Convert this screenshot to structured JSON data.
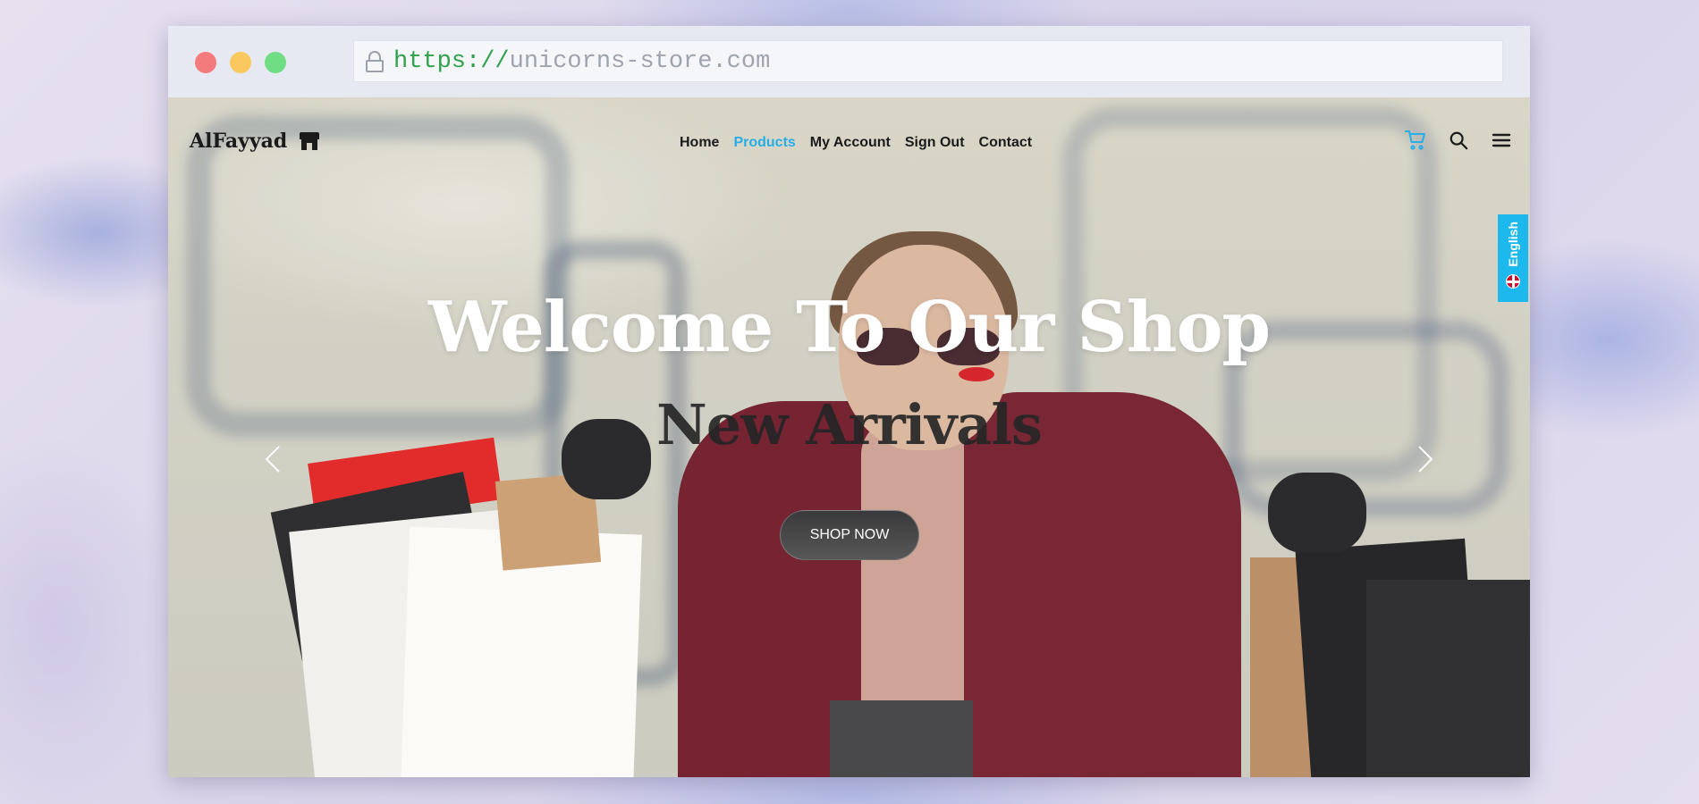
{
  "browser": {
    "url_scheme": "https://",
    "url_host": "unicorns-store.com"
  },
  "nav": {
    "brand": "AlFayyad",
    "menu": [
      {
        "label": "Home",
        "active": false
      },
      {
        "label": "Products",
        "active": true
      },
      {
        "label": "My Account",
        "active": false
      },
      {
        "label": "Sign Out",
        "active": false
      },
      {
        "label": "Contact",
        "active": false
      }
    ],
    "icons": [
      "cart-icon",
      "search-icon",
      "hamburger-menu-icon"
    ]
  },
  "language_tab": {
    "label": "English",
    "flag": "uk-flag-icon"
  },
  "hero": {
    "headline": "Welcome To Our Shop",
    "subheadline": "New Arrivals",
    "cta_label": "SHOP NOW"
  },
  "colors": {
    "accent": "#27aee6",
    "language_tab": "#1cb8ee",
    "cta_background": "#3a3a3c",
    "url_scheme": "#2fa14a"
  }
}
